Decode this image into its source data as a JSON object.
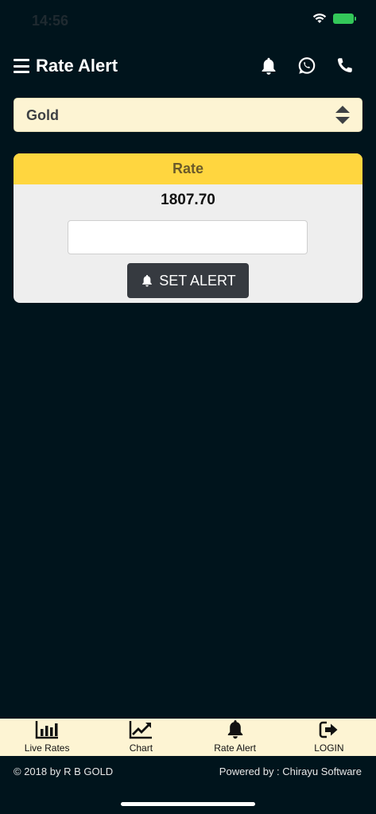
{
  "status_bar": {
    "time": "14:56"
  },
  "header": {
    "title": "Rate Alert",
    "icons": [
      "menu-icon",
      "bell-icon",
      "whatsapp-icon",
      "phone-icon"
    ]
  },
  "select": {
    "selected_value": "Gold"
  },
  "rate_card": {
    "header_label": "Rate",
    "rate_value": "1807.70",
    "input_value": "",
    "set_alert_label": "SET ALERT"
  },
  "bottom_nav": {
    "items": [
      {
        "label": "Live Rates",
        "icon": "bar-chart-icon"
      },
      {
        "label": "Chart",
        "icon": "line-chart-icon"
      },
      {
        "label": "Rate Alert",
        "icon": "bell-icon"
      },
      {
        "label": "LOGIN",
        "icon": "sign-in-icon"
      }
    ]
  },
  "footer": {
    "copyright": "© 2018 by R B GOLD",
    "powered_by": "Powered by : Chirayu Software"
  },
  "colors": {
    "background": "#00141c",
    "accent_yellow": "#ffd63f",
    "cream": "#fdf4d3",
    "button_dark": "#363a40"
  }
}
